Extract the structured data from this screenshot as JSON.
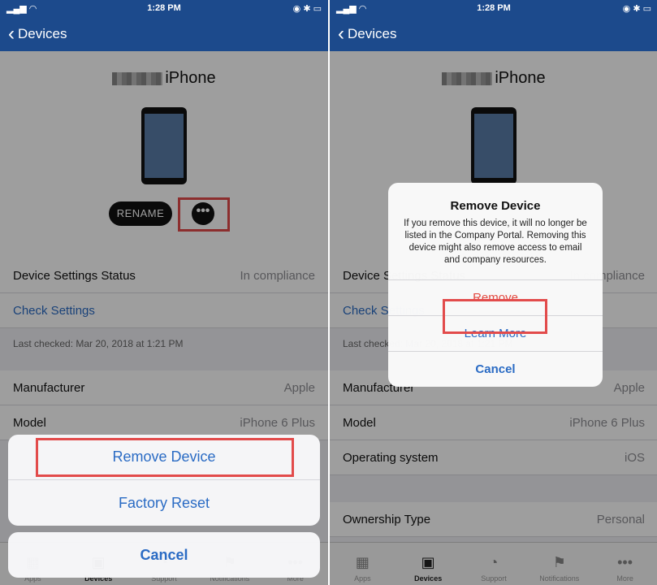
{
  "status_bar": {
    "time": "1:28 PM"
  },
  "nav": {
    "back_label": "Devices"
  },
  "device": {
    "name": "iPhone",
    "rename_label": "RENAME",
    "more_label": "•••"
  },
  "settings": {
    "status_label": "Device Settings Status",
    "status_value": "In compliance",
    "check_settings": "Check Settings",
    "last_checked": "Last checked: Mar 20, 2018 at 1:21 PM"
  },
  "details": [
    {
      "label": "Manufacturer",
      "value": "Apple"
    },
    {
      "label": "Model",
      "value": "iPhone 6 Plus"
    },
    {
      "label": "Operating system",
      "value": "iOS"
    }
  ],
  "ownership": {
    "label": "Ownership Type",
    "value": "Personal"
  },
  "action_sheet": {
    "remove_device": "Remove Device",
    "factory_reset": "Factory Reset",
    "cancel": "Cancel"
  },
  "alert": {
    "title": "Remove Device",
    "message": "If you remove this device, it will no longer be listed in the Company Portal. Removing this device might also remove access to email and company resources.",
    "remove": "Remove",
    "learn_more": "Learn More",
    "cancel": "Cancel"
  },
  "tabs": [
    {
      "label": "Apps",
      "icon": "apps-grid-icon"
    },
    {
      "label": "Devices",
      "icon": "devices-icon"
    },
    {
      "label": "Support",
      "icon": "support-headset-icon"
    },
    {
      "label": "Notifications",
      "icon": "flag-icon"
    },
    {
      "label": "More",
      "icon": "more-dots-icon"
    }
  ],
  "colors": {
    "nav": "#1c4a8c",
    "link": "#2a6bc4",
    "destructive": "#e34a41",
    "highlight": "#e24b4b"
  }
}
